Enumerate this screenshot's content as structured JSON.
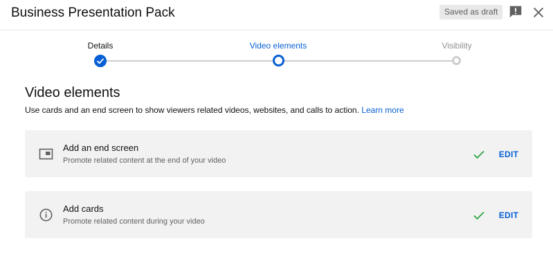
{
  "header": {
    "title": "Business Presentation Pack",
    "draft_status": "Saved as draft",
    "feedback_icon": "feedback-icon",
    "close_icon": "close-icon"
  },
  "stepper": {
    "steps": [
      {
        "label": "Details",
        "state": "completed"
      },
      {
        "label": "Video elements",
        "state": "active"
      },
      {
        "label": "Visibility",
        "state": "upcoming"
      }
    ],
    "accent_color": "#065fd4",
    "inactive_color": "#cccccc"
  },
  "section": {
    "title": "Video elements",
    "description": "Use cards and an end screen to show viewers related videos, websites, and calls to action.",
    "learn_more": "Learn more"
  },
  "cards": [
    {
      "icon": "end-screen-icon",
      "title": "Add an end screen",
      "subtitle": "Promote related content at the end of your video",
      "status_icon": "check-icon",
      "action": "EDIT"
    },
    {
      "icon": "info-icon",
      "title": "Add cards",
      "subtitle": "Promote related content during your video",
      "status_icon": "check-icon",
      "action": "EDIT"
    }
  ],
  "colors": {
    "check": "#2ba640",
    "link": "#065fd4",
    "card_background": "#f2f2f2"
  }
}
